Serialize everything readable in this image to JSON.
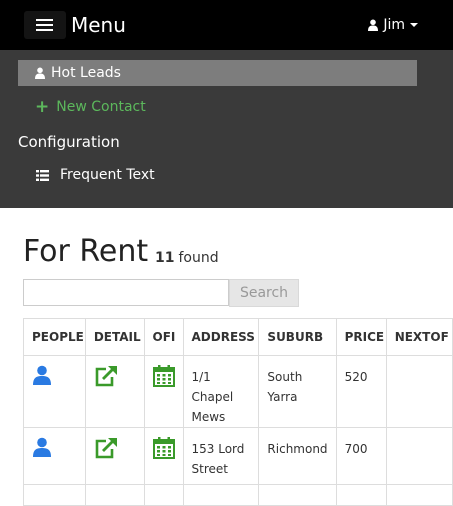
{
  "nav": {
    "brand": "Menu",
    "user": "Jim"
  },
  "dropdown": {
    "items": [
      {
        "label": "Hot Leads",
        "icon": "user-icon",
        "active": true
      },
      {
        "label": "New Contact",
        "icon": "plus-icon",
        "color": "#5cb85c"
      },
      {
        "label": "Configuration",
        "type": "header"
      },
      {
        "label": "Frequent Text",
        "icon": "list-icon"
      }
    ]
  },
  "page": {
    "title": "For Rent",
    "count": "11",
    "count_suffix": "found"
  },
  "search": {
    "value": "",
    "placeholder": "",
    "button_label": "Search"
  },
  "table": {
    "columns": [
      "PEOPLE",
      "DETAIL",
      "OFI",
      "ADDRESS",
      "SUBURB",
      "PRICE",
      "NEXTOF"
    ],
    "rows": [
      {
        "address": "1/1 Chapel Mews",
        "suburb": "South Yarra",
        "price": "520"
      },
      {
        "address": "153 Lord Street",
        "suburb": "Richmond",
        "price": "700"
      }
    ]
  },
  "colors": {
    "people_icon": "#2a7ae2",
    "detail_icon": "#3a9a2a",
    "ofi_icon": "#3a9a2a",
    "accent_green": "#5cb85c"
  }
}
